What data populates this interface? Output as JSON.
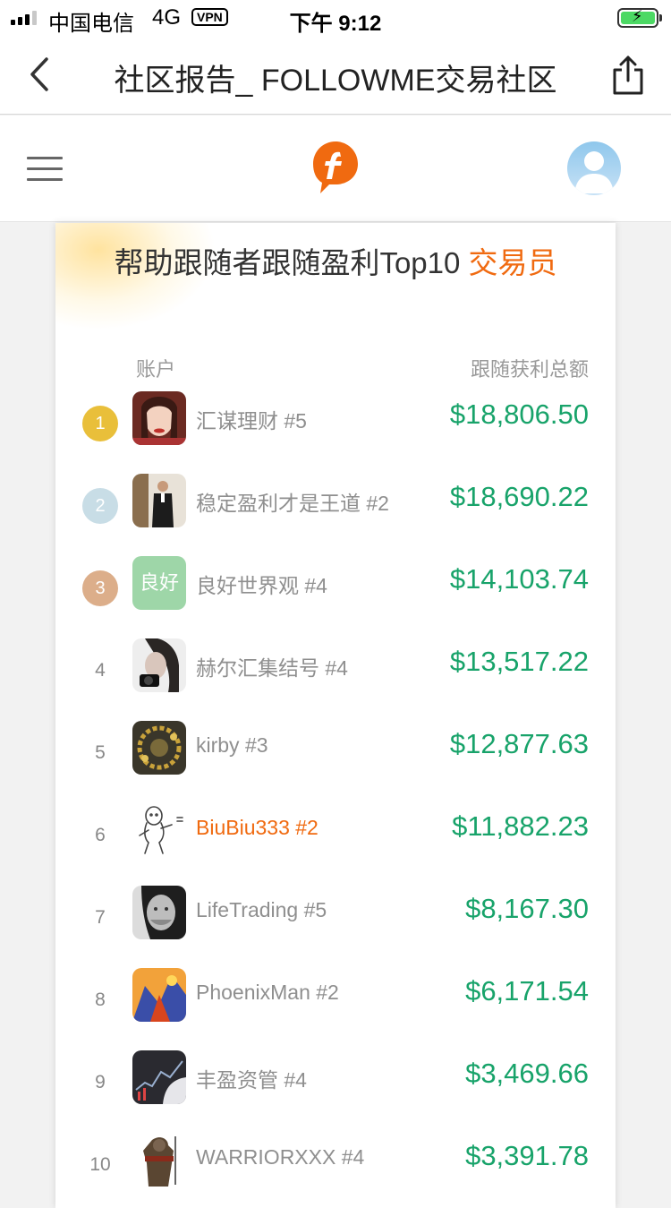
{
  "status_bar": {
    "carrier": "中国电信",
    "network": "4G",
    "vpn": "VPN",
    "time": "下午 9:12"
  },
  "nav": {
    "title": "社区报告_ FOLLOWME交易社区"
  },
  "card": {
    "heading_main": "帮助跟随者跟随盈利Top10",
    "heading_accent": "交易员",
    "col_account": "账户",
    "col_profit": "跟随获利总额"
  },
  "colors": {
    "accent": "#f06a10",
    "profit": "#18a36a",
    "rank1": "#e9bf3a",
    "rank2": "#c8dde6",
    "rank3": "#dcae8a"
  },
  "traders": [
    {
      "rank": "1",
      "name": "汇谋理财 #5",
      "amount": "$18,806.50",
      "avatar": "portrait-woman"
    },
    {
      "rank": "2",
      "name": "稳定盈利才是王道 #2",
      "amount": "$18,690.22",
      "avatar": "portrait-man-suit"
    },
    {
      "rank": "3",
      "name": "良好世界观 #4",
      "amount": "$14,103.74",
      "avatar": "text-avatar",
      "avatar_text": "良好"
    },
    {
      "rank": "4",
      "name": "赫尔汇集结号 #4",
      "amount": "$13,517.22",
      "avatar": "portrait-camera"
    },
    {
      "rank": "5",
      "name": "kirby #3",
      "amount": "$12,877.63",
      "avatar": "gold-beads"
    },
    {
      "rank": "6",
      "name": "BiuBiu333 #2",
      "amount": "$11,882.23",
      "avatar": "sketch-figure"
    },
    {
      "rank": "7",
      "name": "LifeTrading #5",
      "amount": "$8,167.30",
      "avatar": "portrait-smiling-man"
    },
    {
      "rank": "8",
      "name": "PhoenixMan #2",
      "amount": "$6,171.54",
      "avatar": "phoenix-art"
    },
    {
      "rank": "9",
      "name": "丰盈资管 #4",
      "amount": "$3,469.66",
      "avatar": "trading-chart"
    },
    {
      "rank": "10",
      "name": "WARRIORXXX #4",
      "amount": "$3,391.78",
      "avatar": "warrior-figure"
    }
  ]
}
